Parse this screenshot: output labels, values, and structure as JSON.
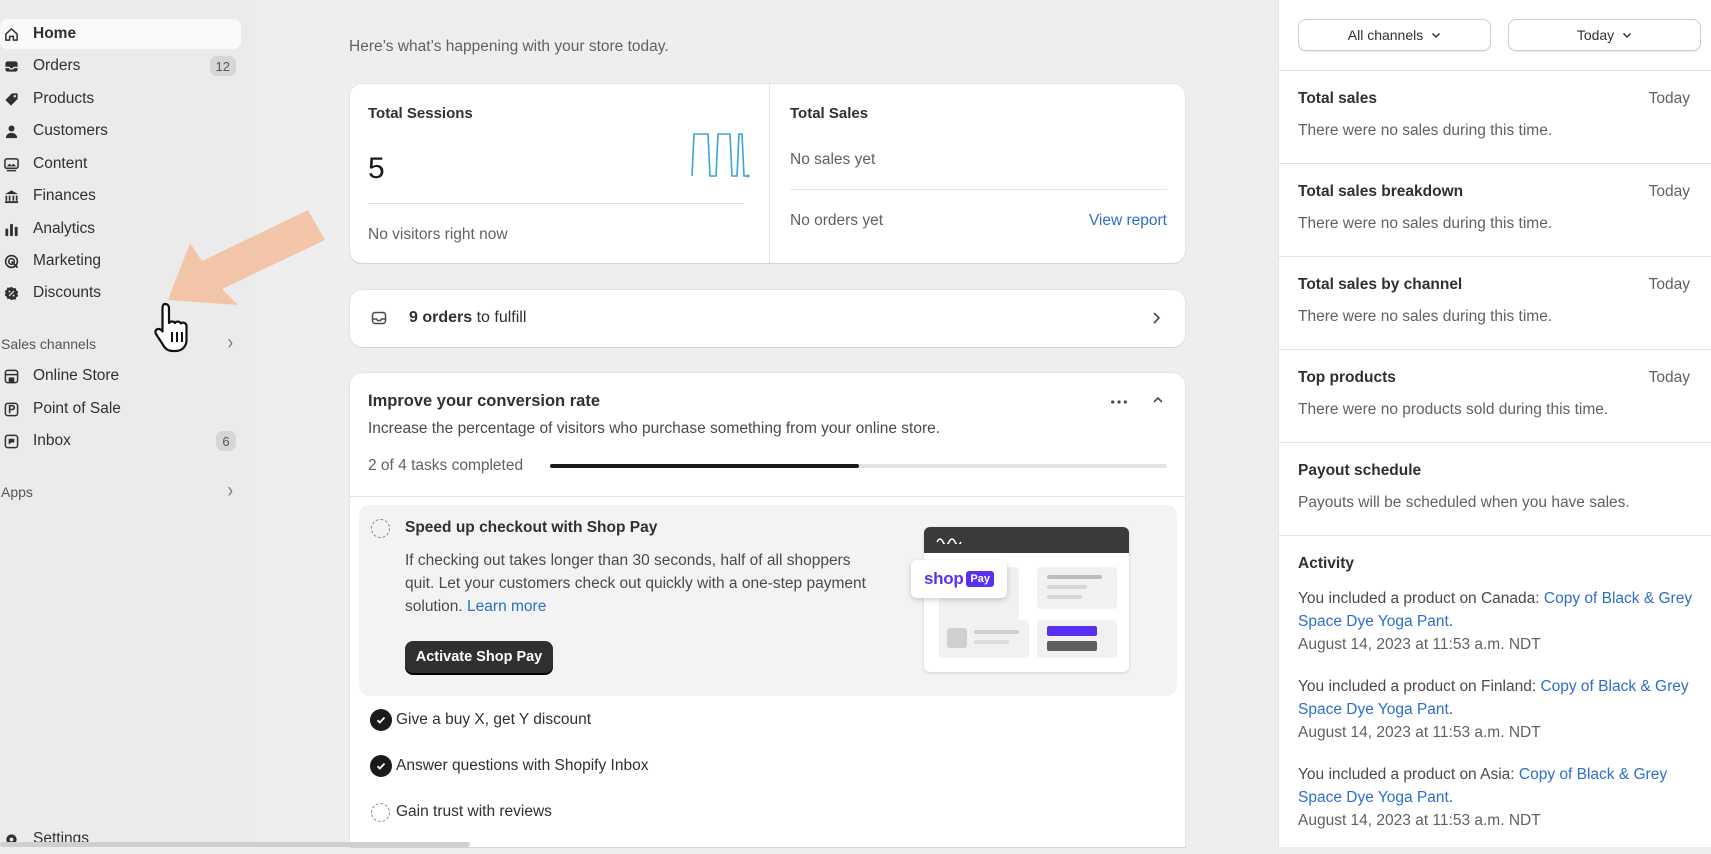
{
  "sidebar": {
    "items": [
      {
        "label": "Home",
        "icon": "home-icon",
        "active": true
      },
      {
        "label": "Orders",
        "icon": "inbox-tray-icon",
        "badge": "12"
      },
      {
        "label": "Products",
        "icon": "tag-icon"
      },
      {
        "label": "Customers",
        "icon": "person-icon"
      },
      {
        "label": "Content",
        "icon": "content-image-icon"
      },
      {
        "label": "Finances",
        "icon": "bank-icon"
      },
      {
        "label": "Analytics",
        "icon": "bar-chart-icon"
      },
      {
        "label": "Marketing",
        "icon": "target-icon"
      },
      {
        "label": "Discounts",
        "icon": "discount-badge-icon"
      }
    ],
    "sales_channels_label": "Sales channels",
    "channel_items": [
      {
        "label": "Online Store",
        "icon": "storefront-icon"
      },
      {
        "label": "Point of Sale",
        "icon": "pos-icon"
      },
      {
        "label": "Inbox",
        "icon": "chat-icon",
        "badge": "6"
      }
    ],
    "apps_label": "Apps",
    "settings_label": "Settings"
  },
  "main": {
    "subtitle": "Here’s what’s happening with your store today.",
    "sessions": {
      "title": "Total Sessions",
      "value": "5",
      "footer": "No visitors right now"
    },
    "sales": {
      "title": "Total Sales",
      "no_sales": "No sales yet",
      "no_orders": "No orders yet",
      "report_link": "View report"
    },
    "orders_to_fulfill": {
      "count_text": "9 orders",
      "rest": " to fulfill"
    },
    "conversion": {
      "title": "Improve your conversion rate",
      "description": "Increase the percentage of visitors who purchase something from your online store.",
      "progress_label": "2 of 4 tasks completed",
      "progress_fraction": 0.5,
      "active_task": {
        "title": "Speed up checkout with Shop Pay",
        "description": "If checking out takes longer than 30 seconds, half of all shoppers quit. Let your customers check out quickly with a one-step payment solution.",
        "learn_more": "Learn more",
        "button": "Activate Shop Pay",
        "logo_text": "shop",
        "logo_badge": "Pay"
      },
      "tasks": [
        {
          "label": "Give a buy X, get Y discount",
          "done": true
        },
        {
          "label": "Answer questions with Shopify Inbox",
          "done": true
        },
        {
          "label": "Gain trust with reviews",
          "done": false
        }
      ]
    }
  },
  "right_panel": {
    "channel_select": "All channels",
    "date_select": "Today",
    "sections": [
      {
        "title": "Total sales",
        "when": "Today",
        "body": "There were no sales during this time."
      },
      {
        "title": "Total sales breakdown",
        "when": "Today",
        "body": "There were no sales during this time."
      },
      {
        "title": "Total sales by channel",
        "when": "Today",
        "body": "There were no sales during this time."
      },
      {
        "title": "Top products",
        "when": "Today",
        "body": "There were no products sold during this time."
      },
      {
        "title": "Payout schedule",
        "when": "",
        "body": "Payouts will be scheduled when you have sales."
      }
    ],
    "activity": {
      "title": "Activity",
      "items": [
        {
          "prefix": "You included a product on Canada: ",
          "link": "Copy of Black & Grey Space Dye Yoga Pant",
          "suffix": ".",
          "date": "August 14, 2023 at 11:53 a.m. NDT"
        },
        {
          "prefix": "You included a product on Finland: ",
          "link": "Copy of Black & Grey Space Dye Yoga Pant",
          "suffix": ".",
          "date": "August 14, 2023 at 11:53 a.m. NDT"
        },
        {
          "prefix": "You included a product on Asia: ",
          "link": "Copy of Black & Grey Space Dye Yoga Pant",
          "suffix": ".",
          "date": "August 14, 2023 at 11:53 a.m. NDT"
        }
      ]
    }
  },
  "colors": {
    "link": "#2c6ecb",
    "primary_button": "#303030",
    "shop_pay": "#5a31f4",
    "sparkline": "#3ba3d6"
  }
}
